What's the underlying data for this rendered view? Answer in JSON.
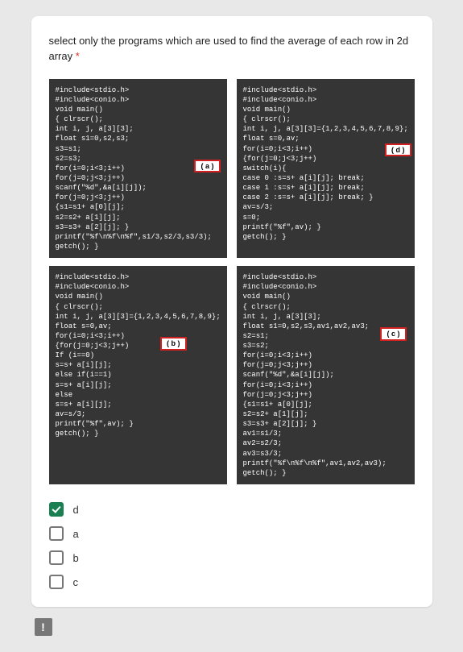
{
  "question": {
    "text": "select only the programs which are used to find the average of each row in 2d array",
    "required_mark": "*"
  },
  "code": {
    "a": "#include<stdio.h>\n#include<conio.h>\nvoid main()\n{ clrscr();\nint i, j, a[3][3];\nfloat s1=0,s2,s3;\ns3=s1;\ns2=s3;\nfor(i=0;i<3;i++)\nfor(j=0;j<3;j++)\nscanf(\"%d\",&a[i][j]);\nfor(j=0;j<3;j++)\n{s1=s1+ a[0][j];\ns2=s2+ a[1][j];\ns3=s3+ a[2][j]; }\nprintf(\"%f\\n%f\\n%f\",s1/3,s2/3,s3/3);\ngetch(); }",
    "d": "#include<stdio.h>\n#include<conio.h>\nvoid main()\n{ clrscr();\nint i, j, a[3][3]={1,2,3,4,5,6,7,8,9};\nfloat s=0,av;\nfor(i=0;i<3;i++)\n{for(j=0;j<3;j++)\nswitch(i){\ncase 0 :s=s+ a[i][j]; break;\ncase 1 :s=s+ a[i][j]; break;\ncase 2 :s=s+ a[i][j]; break; }\nav=s/3;\ns=0;\nprintf(\"%f\",av); }\ngetch(); }",
    "b": "#include<stdio.h>\n#include<conio.h>\nvoid main()\n{ clrscr();\nint i, j, a[3][3]={1,2,3,4,5,6,7,8,9};\nfloat s=0,av;\nfor(i=0;i<3;i++)\n{for(j=0;j<3;j++)\nIf (i==0)\ns=s+ a[i][j];\nelse if(i==1)\ns=s+ a[i][j];\nelse\ns=s+ a[i][j];\nav=s/3;\nprintf(\"%f\",av); }\ngetch(); }",
    "c": "#include<stdio.h>\n#include<conio.h>\nvoid main()\n{ clrscr();\nint i, j, a[3][3];\nfloat s1=0,s2,s3,av1,av2,av3;\ns2=s1;\ns3=s2;\nfor(i=0;i<3;i++)\nfor(j=0;j<3;j++)\nscanf(\"%d\",&a[i][j]);\nfor(i=0;i<3;i++)\nfor(j=0;j<3;j++)\n{s1=s1+ a[0][j];\ns2=s2+ a[1][j];\ns3=s3+ a[2][j]; }\nav1=s1/3;\nav2=s2/3;\nav3=s3/3;\nprintf(\"%f\\n%f\\n%f\",av1,av2,av3);\ngetch(); }"
  },
  "tags": {
    "a": "( a )",
    "b": "( b )",
    "c": "( c )",
    "d": "( d )"
  },
  "options": [
    {
      "label": "d",
      "checked": true
    },
    {
      "label": "a",
      "checked": false
    },
    {
      "label": "b",
      "checked": false
    },
    {
      "label": "c",
      "checked": false
    }
  ],
  "flag": "!"
}
